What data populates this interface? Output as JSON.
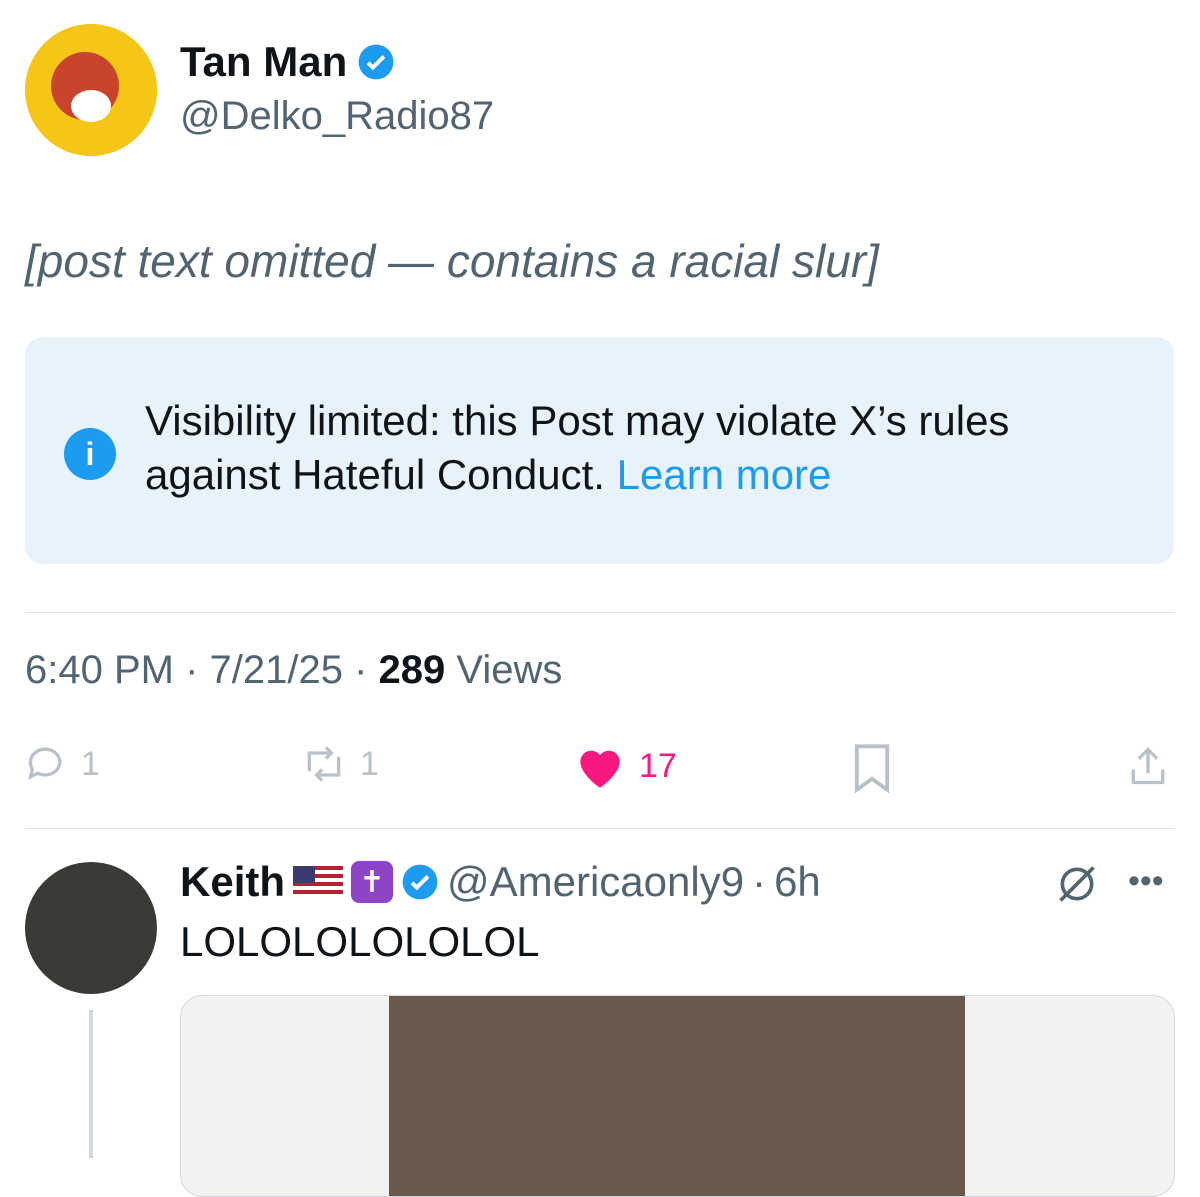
{
  "post": {
    "author_name": "Tan Man",
    "author_handle": "@Delko_Radio87",
    "text_placeholder": "[post text omitted — contains a racial slur]",
    "notice": {
      "text": "Visibility limited: this Post may violate X’s rules against Hateful Conduct.",
      "link": "Learn more"
    },
    "time": "6:40 PM",
    "date": "7/21/25",
    "views_count": "289",
    "views_label": "Views",
    "replies": "1",
    "reposts": "1",
    "likes": "17"
  },
  "reply": {
    "author_name": "Keith",
    "author_handle": "@Americaonly9",
    "age": "6h",
    "text": "LOLOLOLOLOLOL"
  },
  "colors": {
    "accent": "#1d9bf0",
    "like": "#f91880",
    "notice_bg": "#e8f2fb"
  }
}
